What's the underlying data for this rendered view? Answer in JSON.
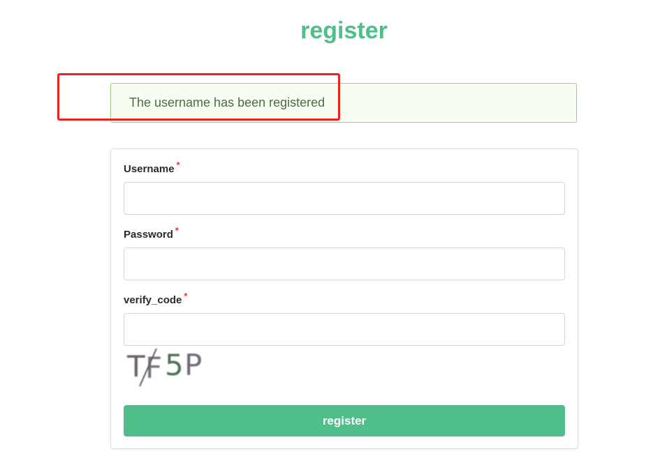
{
  "page": {
    "title": "register"
  },
  "alert": {
    "message": "The username has been registered"
  },
  "form": {
    "username": {
      "label": "Username",
      "required_mark": "*",
      "value": "",
      "placeholder": ""
    },
    "password": {
      "label": "Password",
      "required_mark": "*",
      "value": "",
      "placeholder": ""
    },
    "verify_code": {
      "label": "verify_code",
      "required_mark": "*",
      "value": "",
      "placeholder": ""
    },
    "captcha_text": "TF5P",
    "submit_label": "register"
  },
  "colors": {
    "accent": "#4fbe8a",
    "alert_background": "#f7fdf0",
    "alert_border": "#9ccf8c",
    "highlight_border": "#e8231f",
    "required_mark": "#e23a3a"
  }
}
